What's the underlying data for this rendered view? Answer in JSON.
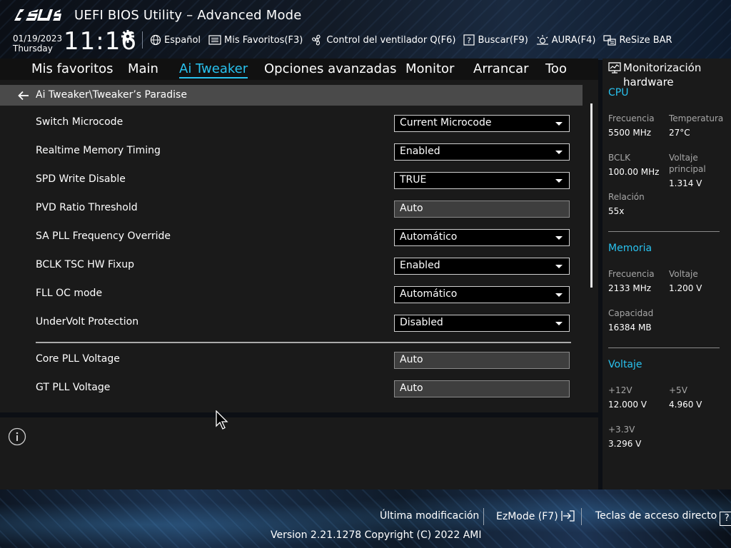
{
  "header": {
    "title": "UEFI BIOS Utility – Advanced Mode",
    "logo_text": "ASUS",
    "date": "01/19/2023",
    "day": "Thursday",
    "time": "11:16",
    "toolbar": [
      {
        "label": "Español",
        "icon": "globe-icon"
      },
      {
        "label": "Mis Favoritos(F3)",
        "icon": "favorites-icon"
      },
      {
        "label": "Control del ventilador Q(F6)",
        "icon": "fan-icon"
      },
      {
        "label": "Buscar(F9)",
        "icon": "search-question-icon"
      },
      {
        "label": "AURA(F4)",
        "icon": "aura-icon"
      },
      {
        "label": "ReSize BAR",
        "icon": "resize-bar-icon"
      }
    ]
  },
  "tabs": [
    {
      "label": "Mis favoritos"
    },
    {
      "label": "Main"
    },
    {
      "label": "Ai Tweaker",
      "active": true
    },
    {
      "label": "Opciones avanzadas"
    },
    {
      "label": "Monitor"
    },
    {
      "label": "Arrancar"
    },
    {
      "label": "Too"
    }
  ],
  "breadcrumb": "Ai Tweaker\\Tweaker’s Paradise",
  "settings": [
    {
      "label": "Switch Microcode",
      "value": "Current Microcode",
      "type": "select"
    },
    {
      "label": "Realtime Memory Timing",
      "value": "Enabled",
      "type": "select"
    },
    {
      "label": "SPD Write Disable",
      "value": "TRUE",
      "type": "select"
    },
    {
      "label": "PVD Ratio Threshold",
      "value": "Auto",
      "type": "field"
    },
    {
      "label": "SA PLL Frequency Override",
      "value": "Automático",
      "type": "select"
    },
    {
      "label": "BCLK TSC HW Fixup",
      "value": "Enabled",
      "type": "select"
    },
    {
      "label": "FLL OC mode",
      "value": "Automático",
      "type": "select"
    },
    {
      "label": "UnderVolt Protection",
      "value": "Disabled",
      "type": "select"
    },
    {
      "label": "Core PLL Voltage",
      "value": "Auto",
      "type": "field"
    },
    {
      "label": "GT PLL Voltage",
      "value": "Auto",
      "type": "field"
    }
  ],
  "hardware": {
    "title_line1": "Monitorización",
    "title_line2": "hardware",
    "cpu": {
      "section": "CPU",
      "freq_label": "Frecuencia",
      "freq": "5500 MHz",
      "temp_label": "Temperatura",
      "temp": "27°C",
      "bclk_label": "BCLK",
      "bclk": "100.00 MHz",
      "vcore_label_1": "Voltaje",
      "vcore_label_2": "principal",
      "vcore": "1.314 V",
      "ratio_label": "Relación",
      "ratio": "55x"
    },
    "memory": {
      "section": "Memoria",
      "freq_label": "Frecuencia",
      "freq": "2133 MHz",
      "volt_label": "Voltaje",
      "volt": "1.200 V",
      "cap_label": "Capacidad",
      "cap": "16384 MB"
    },
    "voltage": {
      "section": "Voltaje",
      "v12_label": "+12V",
      "v12": "12.000 V",
      "v5_label": "+5V",
      "v5": "4.960 V",
      "v33_label": "+3.3V",
      "v33": "3.296 V"
    }
  },
  "footer": {
    "last_modified": "Última modificación",
    "ezmode": "EzMode (F7)",
    "hotkeys": "Teclas de acceso directo",
    "hotkeys_key": "?",
    "version": "Version 2.21.1278 Copyright (C) 2022 AMI"
  },
  "colors": {
    "accent": "#29c2ef",
    "panel": "#1a1a1a",
    "breadcrumb_bg": "#4a4a4a"
  }
}
